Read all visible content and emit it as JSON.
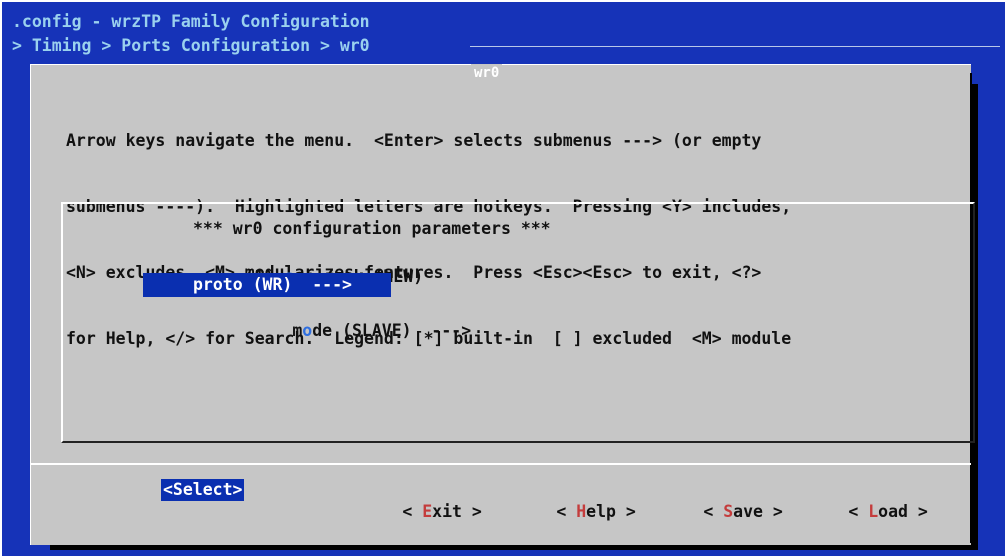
{
  "terminal": {
    "title": ".config - wrzTP Family Configuration",
    "breadcrumb": "> Timing > Ports Configuration > wr0"
  },
  "dialog": {
    "title": "wr0",
    "help_lines": [
      "Arrow keys navigate the menu.  <Enter> selects submenus ---> (or empty",
      "submenus ----).  Highlighted letters are hotkeys.  Pressing <Y> includes,",
      "<N> excludes, <M> modularizes features.  Press <Esc><Esc> to exit, <?>",
      "for Help, </> for Search.  Legend: [*] built-in  [ ] excluded  <M> module"
    ]
  },
  "menu": {
    "header": "*** wr0 configuration parameters ***",
    "items": [
      {
        "prefix": "(1) ",
        "hotkey": "s",
        "rest": "rc_rank (NEW)",
        "selected": false
      },
      {
        "prefix": "",
        "hotkey": "p",
        "rest": "roto (WR)  --->",
        "selected": true
      },
      {
        "prefix": "",
        "hotkey": "m",
        "rest_before": "",
        "text": "mode (SLAVE)  --->",
        "selected": false
      }
    ],
    "item0_prefix": "(1) ",
    "item0_hotkey": "s",
    "item0_rest": "rc_rank (NEW)",
    "item1_text": "proto (WR)  --->",
    "item2_pre": "m",
    "item2_hotkey": "o",
    "item2_rest": "de (SLAVE)  --->"
  },
  "buttons": {
    "select": "<Select>",
    "exit_pre": "< ",
    "exit_hot": "E",
    "exit_rest": "xit >",
    "help_pre": "< ",
    "help_hot": "H",
    "help_rest": "elp >",
    "save_pre": "< ",
    "save_hot": "S",
    "save_rest": "ave >",
    "load_pre": "< ",
    "load_hot": "L",
    "load_rest": "oad >"
  },
  "colors": {
    "terminal_bg": "#1633b8",
    "dialog_bg": "#c6c6c6",
    "selection": "#0a2fb0",
    "hotkey_menu": "#2f6fe0",
    "hotkey_button": "#c43c3c"
  }
}
